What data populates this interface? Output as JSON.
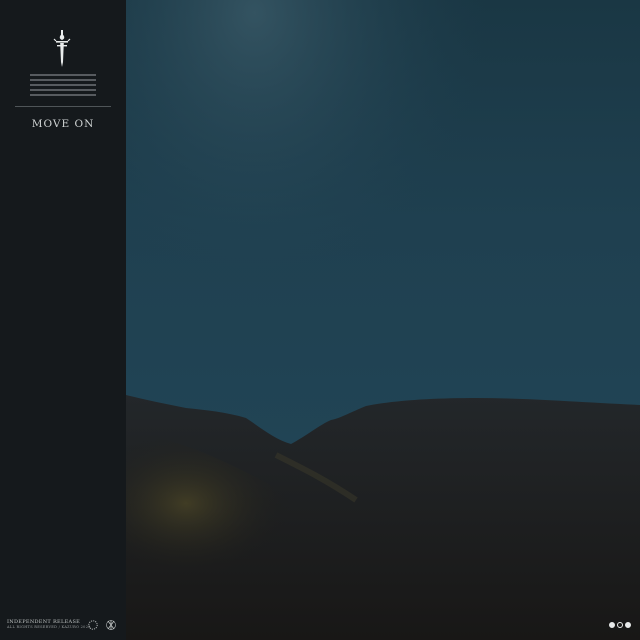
{
  "title": "MOVE ON",
  "footer": {
    "label": "INDEPENDENT RELEASE",
    "sublabel": "ALL RIGHTS RESERVED / KAZURO 2022"
  },
  "icons": {
    "emblem": "dagger-emblem-icon",
    "circle": "dotted-circle-icon",
    "monogram": "monogram-icon"
  },
  "colors": {
    "sidebar": "#15191c",
    "sky": "#1f3f4f",
    "hills": "#1d1c1a",
    "text": "#cfd3d3"
  },
  "dots": [
    {
      "state": "filled"
    },
    {
      "state": "outline"
    },
    {
      "state": "filled"
    }
  ]
}
